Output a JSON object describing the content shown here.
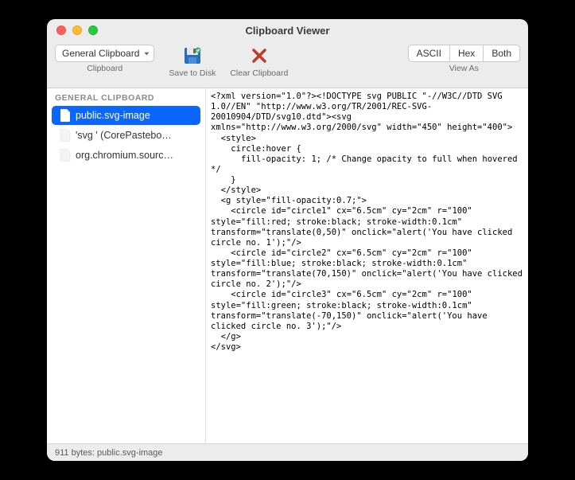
{
  "window": {
    "title": "Clipboard Viewer"
  },
  "toolbar": {
    "dropdown": {
      "value": "General Clipboard",
      "label": "Clipboard"
    },
    "save": {
      "label": "Save to Disk"
    },
    "clear": {
      "label": "Clear Clipboard"
    },
    "viewas": {
      "label": "View As",
      "options": [
        "ASCII",
        "Hex",
        "Both"
      ]
    }
  },
  "sidebar": {
    "section": "GENERAL CLIPBOARD",
    "items": [
      {
        "label": "public.svg-image",
        "selected": true
      },
      {
        "label": "'svg ' (CorePastebo…",
        "selected": false
      },
      {
        "label": "org.chromium.sourc…",
        "selected": false
      }
    ]
  },
  "content": "<?xml version=\"1.0\"?><!DOCTYPE svg PUBLIC \"-//W3C//DTD SVG 1.0//EN\" \"http://www.w3.org/TR/2001/REC-SVG-20010904/DTD/svg10.dtd\"><svg xmlns=\"http://www.w3.org/2000/svg\" width=\"450\" height=\"400\">\n  <style>\n    circle:hover {\n      fill-opacity: 1; /* Change opacity to full when hovered */\n    }\n  </style>\n  <g style=\"fill-opacity:0.7;\">\n    <circle id=\"circle1\" cx=\"6.5cm\" cy=\"2cm\" r=\"100\" style=\"fill:red; stroke:black; stroke-width:0.1cm\" transform=\"translate(0,50)\" onclick=\"alert('You have clicked circle no. 1');\"/>\n    <circle id=\"circle2\" cx=\"6.5cm\" cy=\"2cm\" r=\"100\" style=\"fill:blue; stroke:black; stroke-width:0.1cm\" transform=\"translate(70,150)\" onclick=\"alert('You have clicked circle no. 2');\"/>\n    <circle id=\"circle3\" cx=\"6.5cm\" cy=\"2cm\" r=\"100\" style=\"fill:green; stroke:black; stroke-width:0.1cm\" transform=\"translate(-70,150)\" onclick=\"alert('You have clicked circle no. 3');\"/>\n  </g>\n</svg>",
  "statusbar": {
    "text": "911 bytes: public.svg-image"
  }
}
